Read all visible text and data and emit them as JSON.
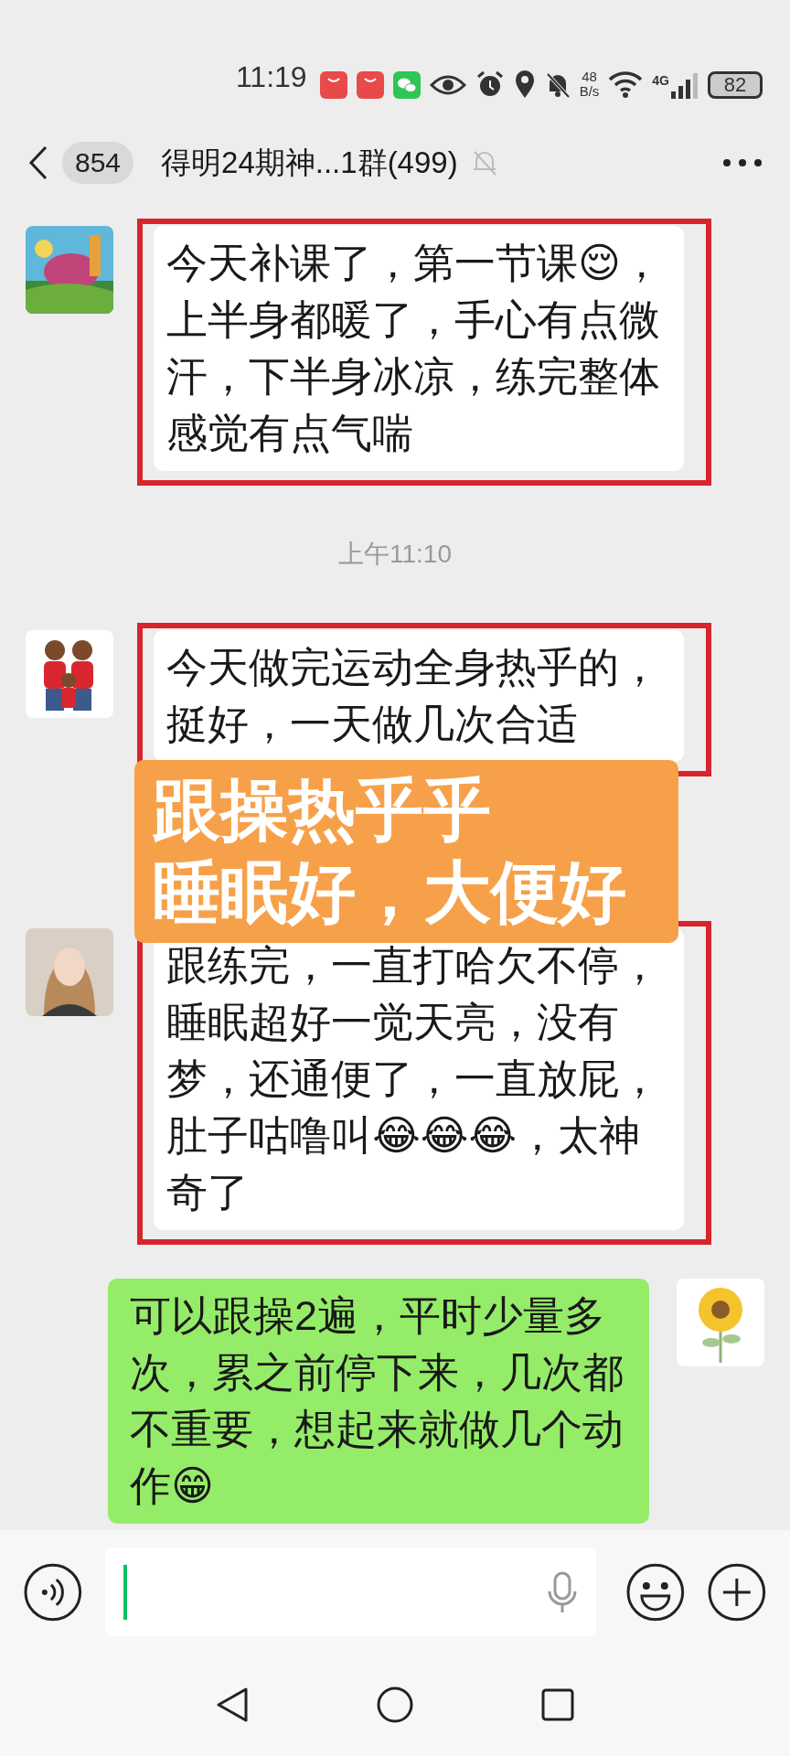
{
  "status_bar": {
    "time": "11:19",
    "speed_value": "48",
    "speed_unit": "B/s",
    "network": "4G",
    "battery": "82"
  },
  "header": {
    "unread_count": "854",
    "title": "得明24期神...1群(499)",
    "muted": true
  },
  "messages": [
    {
      "kind": "received",
      "text": "今天补课了，第一节课😌，上半身都暖了，手心有点微汗，下半身冰凉，练完整体感觉有点气喘",
      "highlighted": true
    },
    {
      "kind": "timestamp",
      "text": "上午11:10"
    },
    {
      "kind": "received",
      "text": "今天做完运动全身热乎的，挺好，一天做几次合适",
      "highlighted": true
    },
    {
      "kind": "caption",
      "lines": [
        "跟操热乎乎",
        "睡眠好，大便好"
      ]
    },
    {
      "kind": "received",
      "text": "跟练完，一直打哈欠不停，睡眠超好一觉天亮，没有梦，还通便了，一直放屁，肚子咕噜叫😂😂😂，太神奇了",
      "highlighted": true
    },
    {
      "kind": "sent",
      "text": "可以跟操2遍，平时少量多次，累之前停下来，几次都不重要，想起来就做几个动作😁",
      "highlighted": false
    }
  ]
}
